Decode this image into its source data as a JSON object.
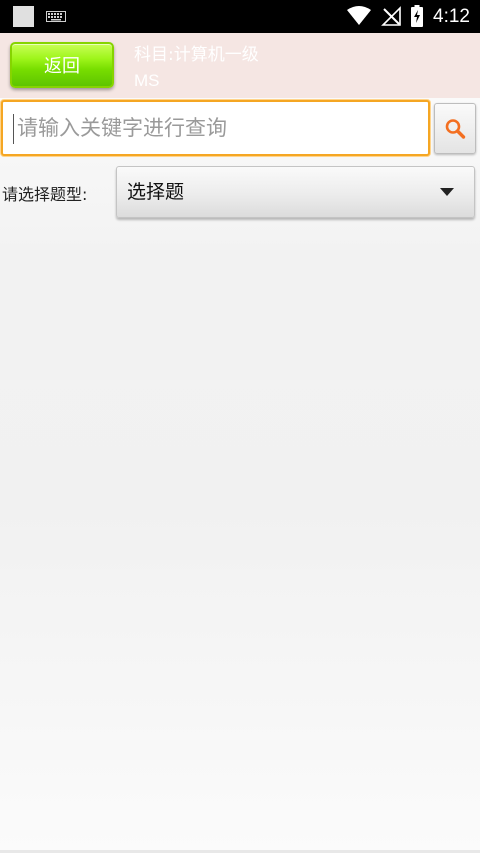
{
  "status_bar": {
    "time": "4:12",
    "icons": [
      "app-notification-icon",
      "keyboard-icon",
      "wifi-icon",
      "signal-off-icon",
      "battery-charging-icon"
    ]
  },
  "header": {
    "back_label": "返回",
    "subject_line": "科目:计算机一级",
    "subject_sub": "MS"
  },
  "search": {
    "placeholder": "请输入关键字进行查询",
    "value": "",
    "button_icon": "search-icon"
  },
  "question_type": {
    "label": "请选择题型:",
    "selected": "选择题"
  },
  "colors": {
    "accent_orange": "#f5a623",
    "back_green": "#78de00",
    "header_bg": "#f5e6e3",
    "search_icon": "#f36f21"
  }
}
